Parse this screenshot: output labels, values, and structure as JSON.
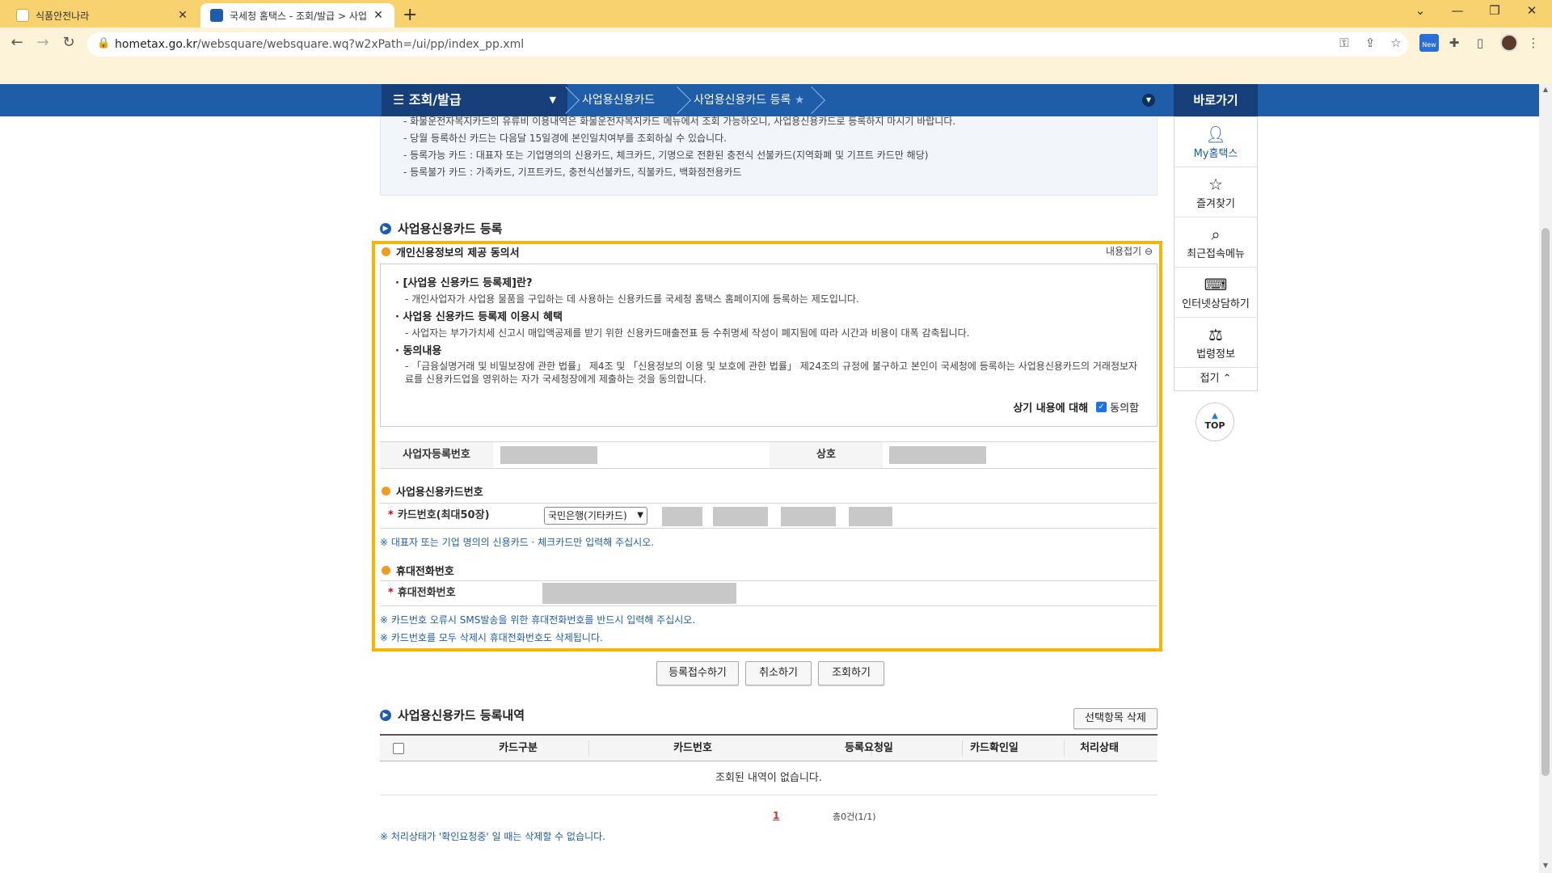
{
  "browser": {
    "tabs": [
      {
        "title": "식품안전나라",
        "active": false
      },
      {
        "title": "국세청 홈택스 - 조회/발급 > 사업",
        "active": true
      }
    ],
    "url_host": "hometax.go.kr",
    "url_path": "/websquare/websquare.wq?w2xPath=/ui/pp/index_pp.xml",
    "new_badge": "New"
  },
  "gnb": {
    "menu": "조회/발급",
    "crumb1": "사업용신용카드",
    "crumb2": "사업용신용카드 등록",
    "quick_title": "바로가기"
  },
  "notice": [
    "- 화물운전자복지카드의 유류비 이용내역은 화물운전자복지카드 메뉴에서 조회 가능하오니, 사업용신용카드로 등록하지 마시기 바랍니다.",
    "- 당월 등록하신 카드는 다음달 15일경에 본인일치여부를 조회하실 수 있습니다.",
    "- 등록가능 카드 : 대표자 또는 기업명의의 신용카드, 체크카드, 기명으로 전환된 충전식 선불카드(지역화폐 및 기프트 카드만 해당)",
    "- 등록불가 카드 : 가족카드, 기프트카드, 충전식선불카드, 직불카드, 백화점전용카드"
  ],
  "register": {
    "title": "사업용신용카드 등록",
    "consent_title": "개인신용정보의 제공 동의서",
    "fold_label": "내용접기",
    "consent": [
      {
        "h": "· [사업용 신용카드 등록제]란?",
        "d": "- 개인사업자가 사업용 물품을 구입하는 데 사용하는 신용카드를 국세청 홈택스 홈페이지에 등록하는 제도입니다."
      },
      {
        "h": "· 사업용 신용카드 등록제 이용시 혜택",
        "d": "- 사업자는 부가가치세 신고시 매입액공제를 받기 위한 신용카드매출전표 등 수취명세 작성이 폐지됨에 따라 시간과 비용이 대폭 감축됩니다."
      },
      {
        "h": "· 동의내용",
        "d": "- 「금융실명거래 및 비밀보장에 관한 법률」 제4조 및 「신용정보의 이용 및 보호에 관한 법률」 제24조의 규정에 불구하고 본인이 국세청에 등록하는 사업용신용카드의 거래정보자료를 신용카드업을 영위하는 자가 국세청장에게 제출하는 것을 동의합니다."
      }
    ],
    "agree_label": "상기 내용에 대해",
    "agree_check": "동의함",
    "biz_no_label": "사업자등록번호",
    "company_label": "상호",
    "card_section": "사업용신용카드번호",
    "card_label": "카드번호(최대50장)",
    "card_company": "국민은행(기타카드)",
    "card_note": "※ 대표자 또는 기업 명의의 신용카드 · 체크카드만 입력해 주십시오.",
    "phone_section": "휴대전화번호",
    "phone_label": "휴대전화번호",
    "phone_note1": "※ 카드번호 오류시 SMS발송을 위한 휴대전화번호를 반드시 입력해 주십시오.",
    "phone_note2": "※ 카드번호를 모두 삭제시 휴대전화번호도 삭제됩니다."
  },
  "buttons": {
    "submit": "등록접수하기",
    "cancel": "취소하기",
    "search": "조회하기",
    "delete_selected": "선택항목 삭제"
  },
  "list": {
    "title": "사업용신용카드 등록내역",
    "columns": [
      "카드구분",
      "카드번호",
      "등록요청일",
      "카드확인일",
      "처리상태"
    ],
    "empty_text": "조회된 내역이 없습니다.",
    "page": "1",
    "total": "총0건(1/1)",
    "note": "※ 처리상태가 '확인요청중' 일 때는 삭제할 수 없습니다."
  },
  "quickmenu": {
    "items": [
      "My홈택스",
      "즐겨찾기",
      "최근접속메뉴",
      "인터넷상담하기",
      "법령정보"
    ],
    "fold": "접기",
    "top": "TOP"
  }
}
